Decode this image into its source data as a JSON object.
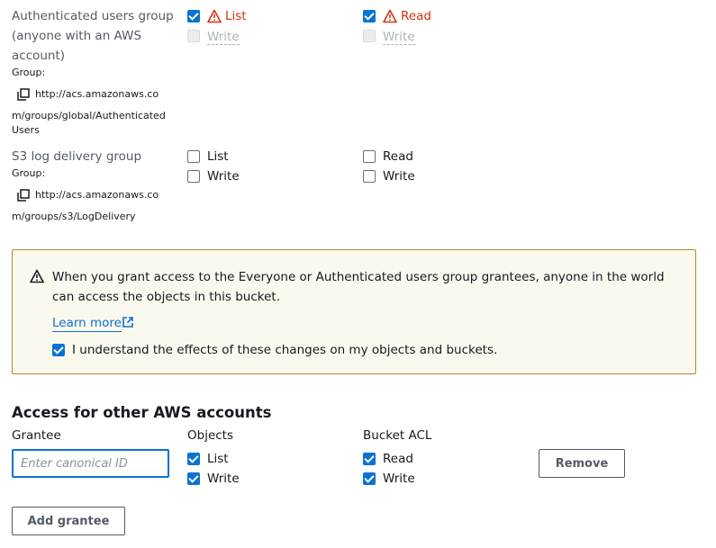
{
  "groups": [
    {
      "title_lines": [
        "Authenticated users group",
        "(anyone with an AWS",
        "account)"
      ],
      "group_label": "Group:",
      "url_lines": [
        "http://acs.amazonaws.co",
        "m/groups/global/Authenticated",
        "Users"
      ],
      "objects": {
        "list": "List",
        "list_checked": true,
        "list_warning": true,
        "write": "Write",
        "write_disabled": true
      },
      "acl": {
        "read": "Read",
        "read_checked": true,
        "read_warning": true,
        "write": "Write",
        "write_disabled": true
      }
    },
    {
      "title_lines": [
        "S3 log delivery group"
      ],
      "group_label": "Group:",
      "url_lines": [
        "http://acs.amazonaws.co",
        "m/groups/s3/LogDelivery"
      ],
      "objects": {
        "list": "List",
        "list_checked": false,
        "write": "Write",
        "write_checked": false
      },
      "acl": {
        "read": "Read",
        "read_checked": false,
        "write": "Write",
        "write_checked": false
      }
    }
  ],
  "alert": {
    "text": "When you grant access to the Everyone or Authenticated users group grantees, anyone in the world can access the objects in this bucket.",
    "learn_more": "Learn more",
    "ack_label": "I understand the effects of these changes on my objects and buckets.",
    "ack_checked": true,
    "warning_color": "#8d6605"
  },
  "other_accounts": {
    "heading": "Access for other AWS accounts",
    "col_grantee": "Grantee",
    "col_objects": "Objects",
    "col_acl": "Bucket ACL",
    "grantee_placeholder": "Enter canonical ID",
    "grantee_value": "",
    "objects": {
      "list": "List",
      "list_checked": true,
      "write": "Write",
      "write_checked": true
    },
    "acl": {
      "read": "Read",
      "read_checked": true,
      "write": "Write",
      "write_checked": true
    },
    "remove_button": "Remove",
    "add_button": "Add grantee"
  },
  "colors": {
    "accent": "#0972d3",
    "warning_text": "#d13212",
    "alert_bg": "#fbf8ee",
    "alert_border": "#b08a2e"
  }
}
